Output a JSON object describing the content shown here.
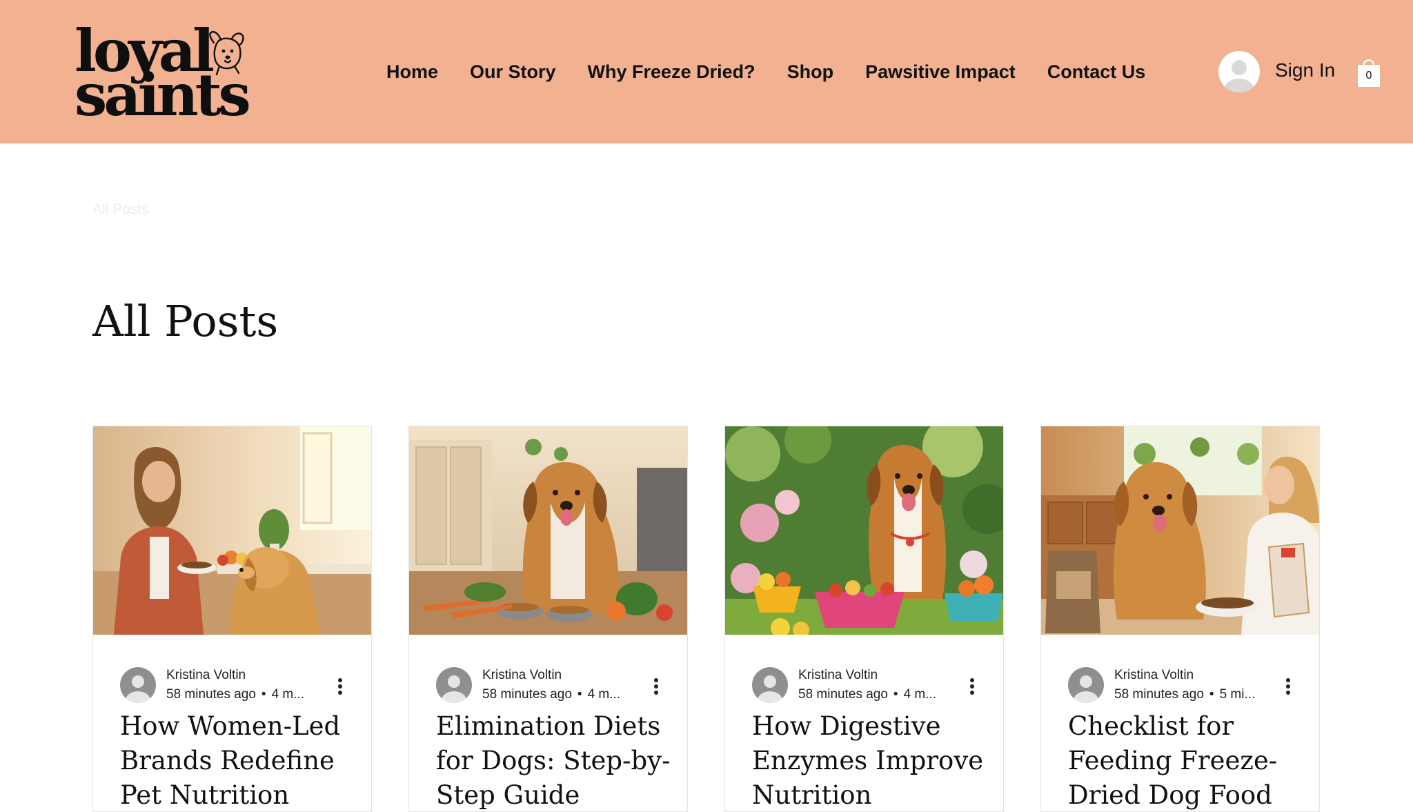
{
  "brand": {
    "logo_line1": "loyal",
    "logo_line2": "saints",
    "logo_icon": "dog-head-icon",
    "header_color": "#f2b292"
  },
  "nav": {
    "items": [
      {
        "label": "Home"
      },
      {
        "label": "Our Story"
      },
      {
        "label": "Why Freeze Dried?"
      },
      {
        "label": "Shop"
      },
      {
        "label": "Pawsitive Impact"
      },
      {
        "label": "Contact Us"
      }
    ]
  },
  "account": {
    "avatar_icon": "user-avatar-icon",
    "sign_in_label": "Sign In"
  },
  "cart": {
    "icon": "shopping-bag-icon",
    "count": "0"
  },
  "breadcrumb": {
    "label": "All Posts"
  },
  "page": {
    "title": "All Posts"
  },
  "posts": [
    {
      "author": "Kristina Voltin",
      "time": "58 minutes ago",
      "read_time": "4 m...",
      "title": "How Women-Led Brands Redefine Pet Nutrition",
      "image": "woman-feeding-golden-retriever-in-kitchen"
    },
    {
      "author": "Kristina Voltin",
      "time": "58 minutes ago",
      "read_time": "4 m...",
      "title": "Elimination Diets for Dogs: Step-by-Step Guide",
      "image": "dog-with-vegetables-and-bowls-on-kitchen-floor"
    },
    {
      "author": "Kristina Voltin",
      "time": "58 minutes ago",
      "read_time": "4 m...",
      "title": "How Digestive Enzymes Improve Nutrition",
      "image": "dog-in-garden-with-fruit-bowls"
    },
    {
      "author": "Kristina Voltin",
      "time": "58 minutes ago",
      "read_time": "5 mi...",
      "title": "Checklist for Feeding Freeze-Dried Dog Food",
      "image": "woman-with-golden-retriever-and-freeze-dried-food-bags"
    }
  ]
}
